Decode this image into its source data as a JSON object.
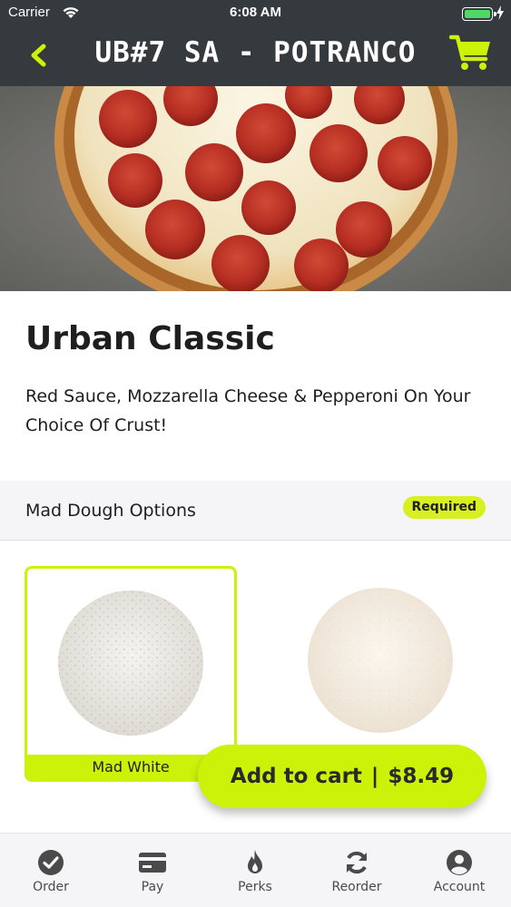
{
  "status_bar": {
    "carrier": "Carrier",
    "time": "6:08 AM"
  },
  "header": {
    "title": "UB#7 SA - POTRANCO",
    "back_icon": "chevron-left-icon",
    "cart_icon": "cart-icon"
  },
  "product": {
    "name": "Urban Classic",
    "description": "Red Sauce, Mozzarella Cheese & Pepperoni On Your Choice Of Crust!"
  },
  "options_section": {
    "title": "Mad Dough Options",
    "badge": "Required",
    "options": [
      {
        "label": "Mad White",
        "selected": true
      },
      {
        "label": "",
        "selected": false
      }
    ]
  },
  "cart_button": {
    "label": "Add to cart",
    "separator": "|",
    "price": "$8.49"
  },
  "tab_bar": {
    "tabs": [
      {
        "label": "Order",
        "icon": "check-circle-icon"
      },
      {
        "label": "Pay",
        "icon": "credit-card-icon"
      },
      {
        "label": "Perks",
        "icon": "flame-icon"
      },
      {
        "label": "Reorder",
        "icon": "refresh-icon"
      },
      {
        "label": "Account",
        "icon": "user-circle-icon"
      }
    ]
  },
  "colors": {
    "accent": "#cdf20a",
    "header_bg": "#353a3e",
    "text": "#1e1e1e"
  }
}
